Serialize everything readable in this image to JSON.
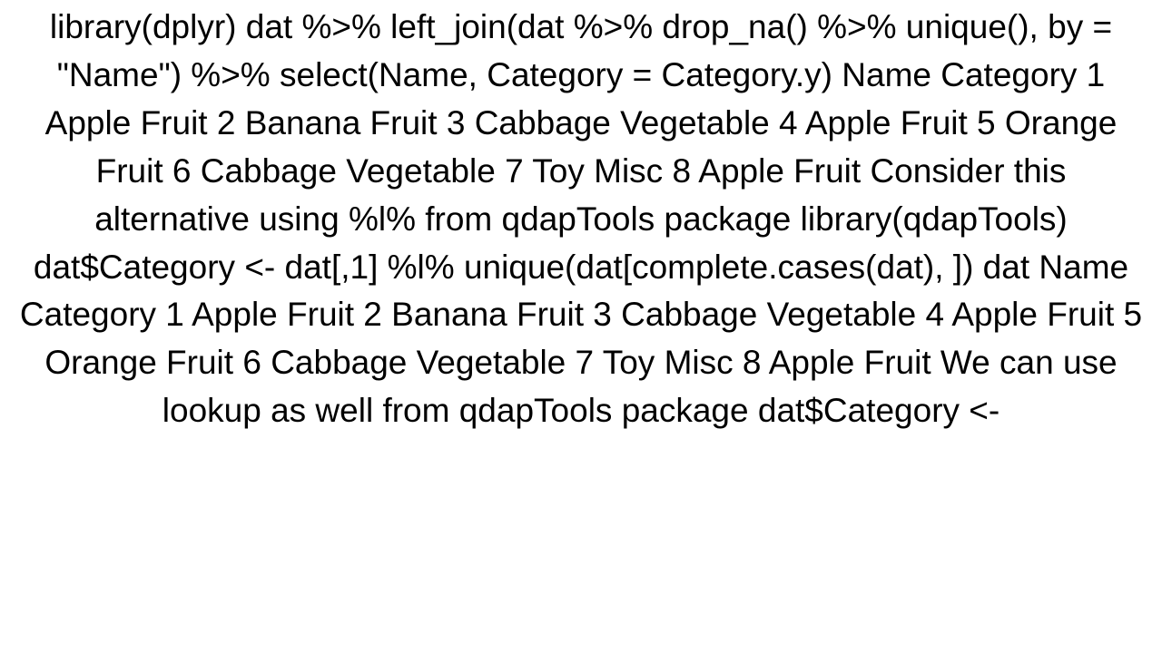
{
  "text": "library(dplyr) dat %>%    left_join(dat %>%             drop_na() %>%               unique(), by = \"Name\") %>%   select(Name,          Category = Category.y)      Name  Category 1   Apple     Fruit 2  Banana     Fruit 3 Cabbage Vegetable 4   Apple     Fruit 5  Orange     Fruit 6 Cabbage Vegetable 7     Toy      Misc 8   Apple     Fruit  Consider this alternative using %l% from qdapTools package library(qdapTools) dat$Category <-  dat[,1] %l% unique(dat[complete.cases(dat), ])   dat      Name  Category 1   Apple     Fruit 2  Banana     Fruit 3 Cabbage Vegetable 4   Apple     Fruit 5  Orange     Fruit 6 Cabbage Vegetable 7     Toy      Misc 8   Apple     Fruit  We can use lookup as well from qdapTools package dat$Category <-"
}
